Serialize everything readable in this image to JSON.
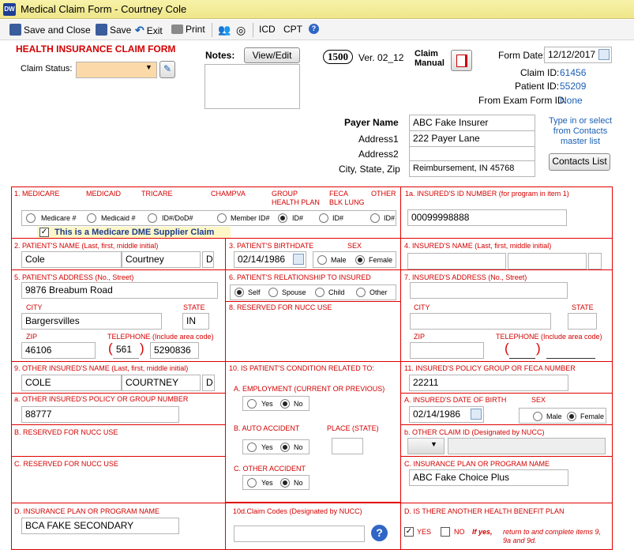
{
  "window": {
    "icon_text": "DW",
    "title": "Medical Claim Form - Courtney Cole"
  },
  "toolbar": {
    "save_close": "Save and Close",
    "save": "Save",
    "exit": "Exit",
    "print": "Print",
    "icd": "ICD",
    "cpt": "CPT"
  },
  "header": {
    "form_title": "HEALTH INSURANCE CLAIM FORM",
    "claim_status_label": "Claim Status:",
    "claim_status_value": "",
    "notes_label": "Notes:",
    "view_edit": "View/Edit",
    "badge_1500": "1500",
    "version": "Ver. 02_12",
    "claim_manual": "Claim Manual",
    "form_date_label": "Form Date:",
    "form_date": "12/12/2017",
    "claim_id_label": "Claim ID:",
    "claim_id": "61456",
    "patient_id_label": "Patient ID:",
    "patient_id": "55209",
    "from_exam_label": "From Exam Form ID:",
    "from_exam": "None"
  },
  "payer": {
    "name_label": "Payer Name",
    "name": "ABC Fake Insurer",
    "address1_label": "Address1",
    "address1": "222 Payer Lane",
    "address2_label": "Address2",
    "address2": "",
    "csz_label": "City, State, Zip",
    "csz": "Reimbursement, IN 45768",
    "hint": "Type in or select from Contacts master list",
    "contacts_btn": "Contacts List"
  },
  "box1": {
    "label": "1. MEDICARE",
    "medicaid": "MEDICAID",
    "tricare": "TRICARE",
    "champva": "CHAMPVA",
    "group": "GROUP",
    "health_plan": "HEALTH PLAN",
    "feca": "FECA",
    "blk_lung": "BLK LUNG",
    "other": "OTHER",
    "opt_medicare": "Medicare #",
    "opt_medicaid": "Medicaid #",
    "opt_id_dod": "ID#/DoD#",
    "opt_member": "Member ID#",
    "opt_group_id": "ID#",
    "opt_feca_id": "ID#",
    "opt_other_id": "ID#",
    "dme": "This is a Medicare DME Supplier Claim"
  },
  "box1a": {
    "label": "1a.  INSURED'S ID NUMBER (for program in item 1)",
    "value": "00099998888"
  },
  "box2": {
    "label": "2.  PATIENT'S NAME (Last, first, middle initial)",
    "last": "Cole",
    "first": "Courtney",
    "mi": "D"
  },
  "box3": {
    "label": "3.  PATIENT'S BIRTHDATE",
    "sex_label": "SEX",
    "dob": "02/14/1986",
    "male": "Male",
    "female": "Female"
  },
  "box4": {
    "label": "4.  INSURED'S NAME (Last, first, middle initial)"
  },
  "box5": {
    "label": "5.  PATIENT'S ADDRESS (No., Street)",
    "street": "9876 Breabum Road",
    "city_label": "CITY",
    "city": "Bargersvilles",
    "state_label": "STATE",
    "state": "IN",
    "zip_label": "ZIP",
    "zip": "46106",
    "tel_label": "TELEPHONE (Include area code)",
    "area": "561",
    "phone": "5290836"
  },
  "box6": {
    "label": "6.  PATIENT'S RELATIONSHIP TO INSURED",
    "self": "Self",
    "spouse": "Spouse",
    "child": "Child",
    "other": "Other"
  },
  "box7": {
    "label": "7.  INSURED'S ADDRESS (No., Street)",
    "city_label": "CITY",
    "state_label": "STATE",
    "zip_label": "ZIP",
    "tel_label": "TELEPHONE (Include area code)",
    "area": "",
    "phone": ""
  },
  "box8": {
    "label": "8.  RESERVED FOR NUCC USE"
  },
  "box9": {
    "label": "9.  OTHER INSURED'S NAME (Last, first, middle initial)",
    "last": "COLE",
    "first": "COURTNEY",
    "mi": "D"
  },
  "box9a": {
    "label": "a.  OTHER INSURED'S POLICY OR GROUP NUMBER",
    "value": "88777"
  },
  "box9b": {
    "label": "b.  RESERVED FOR NUCC USE"
  },
  "box9c": {
    "label": "c.  RESERVED FOR NUCC USE"
  },
  "box9d": {
    "label": "d.  INSURANCE PLAN OR PROGRAM NAME",
    "value": "BCA FAKE SECONDARY"
  },
  "box10": {
    "label": "10.  IS PATIENT'S CONDITION RELATED TO:",
    "a": "a. EMPLOYMENT (CURRENT OR PREVIOUS)",
    "b": "b. AUTO ACCIDENT",
    "place": "PLACE (State)",
    "c": "c. OTHER ACCIDENT",
    "yes": "Yes",
    "no": "No"
  },
  "box10d": {
    "label": "10d.Claim Codes (Designated by NUCC)"
  },
  "box11": {
    "label": "11.  INSURED'S POLICY GROUP OR FECA NUMBER",
    "value": "22211"
  },
  "box11a": {
    "label": "a.  INSURED'S DATE OF BIRTH",
    "sex_label": "SEX",
    "dob": "02/14/1986",
    "male": "Male",
    "female": "Female"
  },
  "box11b": {
    "label": "b.  OTHER CLAIM ID (Designated by NUCC)"
  },
  "box11c": {
    "label": "c.  INSURANCE PLAN OR PROGRAM NAME",
    "value": "ABC Fake Choice Plus"
  },
  "box11d": {
    "label": "d.  IS THERE ANOTHER HEALTH BENEFIT PLAN",
    "yes": "YES",
    "no": "NO",
    "note_bold": "If yes,",
    "note": "return to and complete items 9, 9a and 9d."
  },
  "colors": {
    "accent_red": "#d40000",
    "link_blue": "#1a5fb4",
    "titlebar": "#f2ea97",
    "status_fill": "#fbd9a8"
  }
}
